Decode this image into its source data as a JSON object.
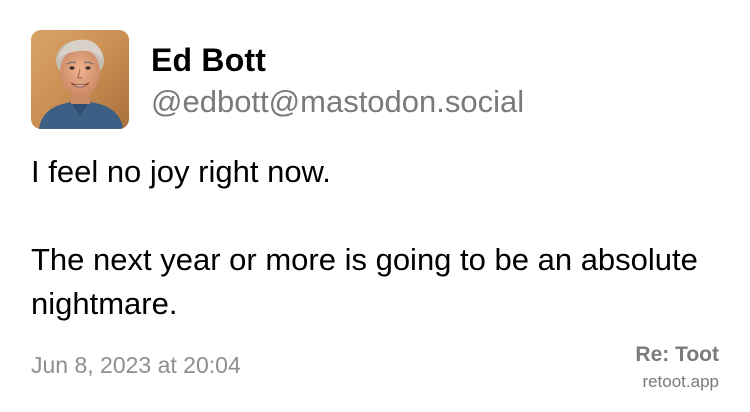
{
  "author": {
    "display_name": "Ed Bott",
    "handle": "@edbott@mastodon.social",
    "avatar": "profile-photo"
  },
  "post": {
    "paragraphs": [
      "I feel no joy right now.",
      "The next year or more is going to be an absolute nightmare."
    ],
    "timestamp": "Jun 8, 2023 at 20:04"
  },
  "branding": {
    "title": "Re: Toot",
    "url": "retoot.app"
  },
  "colors": {
    "secondary_text": "#7a7a7e",
    "timestamp_text": "#8e8e93"
  }
}
